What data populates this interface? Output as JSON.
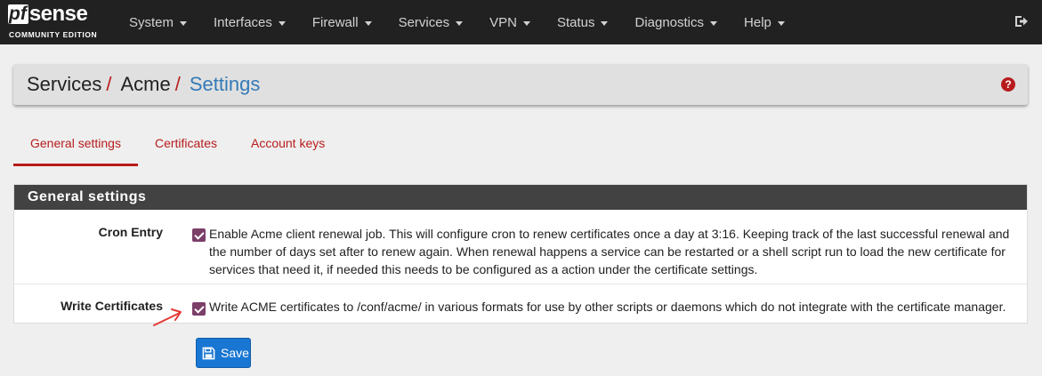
{
  "brand": {
    "pf": "pf",
    "sense": "sense",
    "edition": "COMMUNITY EDITION"
  },
  "nav": {
    "items": [
      {
        "label": "System"
      },
      {
        "label": "Interfaces"
      },
      {
        "label": "Firewall"
      },
      {
        "label": "Services"
      },
      {
        "label": "VPN"
      },
      {
        "label": "Status"
      },
      {
        "label": "Diagnostics"
      },
      {
        "label": "Help"
      }
    ],
    "logout_icon": "sign-out-icon"
  },
  "breadcrumb": {
    "items": [
      "Services",
      "Acme"
    ],
    "separator": "/",
    "active": "Settings",
    "help_icon": "question-circle-icon",
    "help_glyph": "?"
  },
  "tabs": [
    {
      "label": "General settings",
      "active": true
    },
    {
      "label": "Certificates",
      "active": false
    },
    {
      "label": "Account keys",
      "active": false
    }
  ],
  "panel": {
    "title": "General settings",
    "rows": [
      {
        "label": "Cron Entry",
        "checked": true,
        "description": "Enable Acme client renewal job. This will configure cron to renew certificates once a day at 3:16. Keeping track of the last successful renewal and the number of days set after to renew again. When renewal happens a service can be restarted or a shell script run to load the new certificate for services that need it, if needed this needs to be configured as a action under the certificate settings."
      },
      {
        "label": "Write Certificates",
        "checked": true,
        "description": "Write ACME certificates to /conf/acme/ in various formats for use by other scripts or daemons which do not integrate with the certificate manager."
      }
    ]
  },
  "save_button": {
    "label": "Save",
    "icon": "save-icon"
  },
  "colors": {
    "navbar": "#212121",
    "accent_red": "#b71c1c",
    "link_blue": "#337ab7",
    "button_blue": "#1976d2",
    "checkbox_purple": "#7b3f68",
    "panel_heading": "#424242"
  }
}
